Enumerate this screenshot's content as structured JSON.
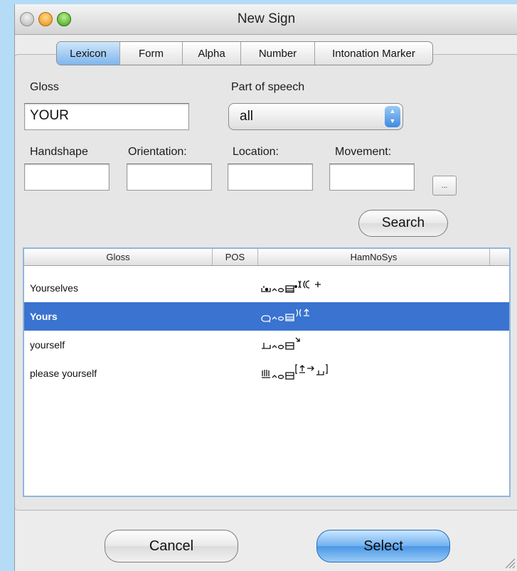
{
  "window": {
    "title": "New Sign"
  },
  "tabs": [
    "Lexicon",
    "Form",
    "Alpha",
    "Number",
    "Intonation Marker"
  ],
  "form": {
    "gloss_label": "Gloss",
    "gloss_value": "YOUR",
    "pos_label": "Part of speech",
    "pos_value": "all",
    "handshape_label": "Handshape",
    "orientation_label": "Orientation:",
    "location_label": "Location:",
    "movement_label": "Movement:",
    "dots_label": "...",
    "search_label": "Search"
  },
  "table": {
    "columns": [
      "Gloss",
      "POS",
      "HamNoSys"
    ],
    "rows": [
      {
        "gloss": "Yourselves",
        "pos": "",
        "hamnosys_icon": "hamnosys-notation-1"
      },
      {
        "gloss": "Yours",
        "pos": "",
        "hamnosys_icon": "hamnosys-notation-2",
        "selected": true
      },
      {
        "gloss": "yourself",
        "pos": "",
        "hamnosys_icon": "hamnosys-notation-3"
      },
      {
        "gloss": "please yourself",
        "pos": "",
        "hamnosys_icon": "hamnosys-notation-4"
      }
    ]
  },
  "buttons": {
    "cancel": "Cancel",
    "select": "Select"
  },
  "colors": {
    "background": "#b4dcf6",
    "selection": "#3a73d0",
    "accent": "#4a97e6"
  }
}
